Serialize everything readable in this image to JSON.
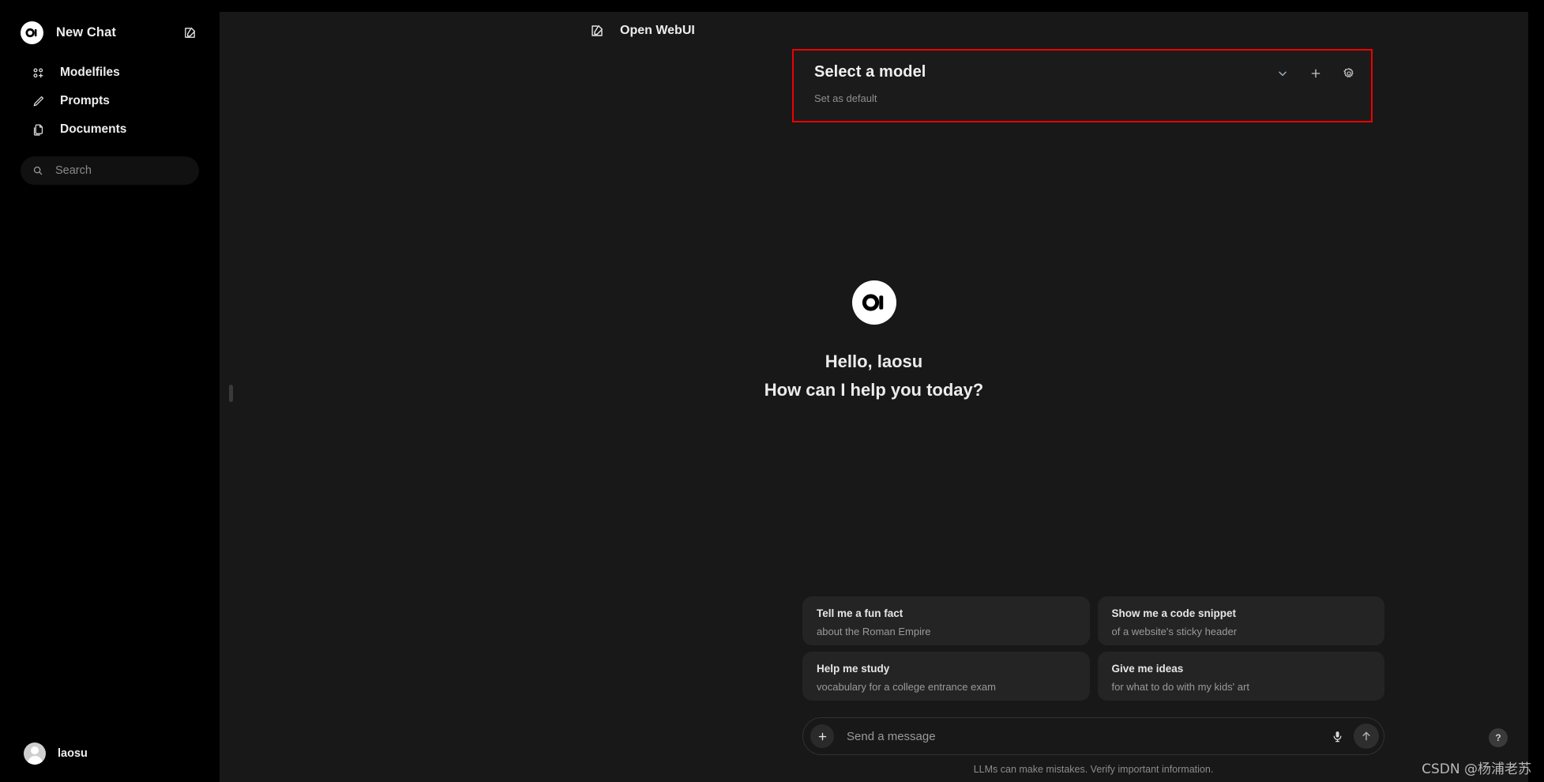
{
  "sidebar": {
    "new_chat": {
      "label": "New Chat",
      "logo_icon": "openwebui-logo-icon",
      "edit_icon": "new-chat-edit-icon"
    },
    "items": [
      {
        "label": "Modelfiles",
        "icon": "modelfiles-grid-plus-icon"
      },
      {
        "label": "Prompts",
        "icon": "pencil-icon"
      },
      {
        "label": "Documents",
        "icon": "documents-copy-icon"
      }
    ],
    "search": {
      "placeholder": "Search",
      "value": "",
      "icon": "search-icon"
    },
    "user": {
      "name": "laosu",
      "avatar_icon": "avatar-icon"
    }
  },
  "topbar": {
    "title": "Open WebUI",
    "edit_icon": "new-chat-edit-icon"
  },
  "model_selector": {
    "title": "Select a model",
    "subtitle": "Set as default",
    "highlight_color": "#ee0000",
    "actions": [
      {
        "name": "chevron-down-icon",
        "label": ""
      },
      {
        "name": "plus-icon",
        "label": ""
      },
      {
        "name": "gear-icon",
        "label": ""
      }
    ]
  },
  "hero": {
    "logo_icon": "openwebui-logo-icon",
    "greeting": "Hello, laosu",
    "question": "How can I help you today?"
  },
  "suggestions": [
    {
      "title": "Tell me a fun fact",
      "subtitle": "about the Roman Empire"
    },
    {
      "title": "Show me a code snippet",
      "subtitle": "of a website's sticky header"
    },
    {
      "title": "Help me study",
      "subtitle": "vocabulary for a college entrance exam"
    },
    {
      "title": "Give me ideas",
      "subtitle": "for what to do with my kids' art"
    }
  ],
  "composer": {
    "placeholder": "Send a message",
    "value": "",
    "plus_icon": "plus-icon",
    "mic_icon": "microphone-icon",
    "send_icon": "send-arrow-up-icon",
    "note": "LLMs can make mistakes. Verify important information."
  },
  "help_button": {
    "label": "?"
  },
  "watermark": {
    "text": "CSDN @杨浦老苏"
  }
}
